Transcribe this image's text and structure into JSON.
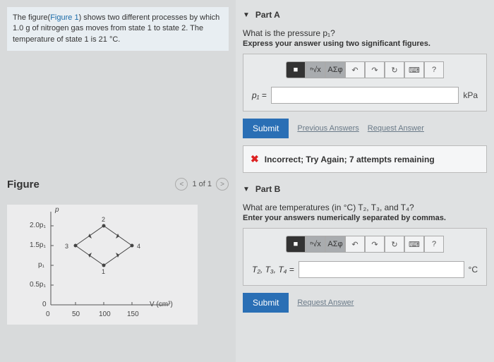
{
  "problem": {
    "text_before": "The figure(",
    "link": "Figure 1",
    "text_after": ") shows two different processes by which 1.0 g of nitrogen gas moves from state 1 to state 2. The temperature of state 1 is 21 °C."
  },
  "figure": {
    "heading": "Figure",
    "nav": "1 of 1",
    "ylabel": "p",
    "xlabel": "V (cm³)",
    "yticks": [
      "2.0p₁",
      "1.5p₁",
      "p₁",
      "0.5p₁",
      "0"
    ],
    "xticks": [
      "0",
      "50",
      "100",
      "150"
    ],
    "points": {
      "top": "2",
      "right": "4",
      "bottom": "1",
      "left": "3"
    }
  },
  "partA": {
    "title": "Part A",
    "question": "What is the pressure p₁?",
    "instruction": "Express your answer using two significant figures.",
    "varlabel": "p₁ =",
    "unit": "kPa",
    "submit": "Submit",
    "prev": "Previous Answers",
    "req": "Request Answer",
    "feedback": "Incorrect; Try Again; 7 attempts remaining"
  },
  "partB": {
    "title": "Part B",
    "question": "What are temperatures (in °C) T₂, T₃, and T₄?",
    "instruction": "Enter your answers numerically separated by commas.",
    "varlabel": "T₂, T₃, T₄ =",
    "unit": "°C",
    "submit": "Submit",
    "req": "Request Answer"
  },
  "toolbar": {
    "sqrt": "ⁿ√x",
    "greek": "ΑΣφ",
    "undo": "↶",
    "redo": "↷",
    "reset": "↻",
    "kbd": "⌨",
    "help": "?"
  },
  "chart_data": {
    "type": "line",
    "title": "",
    "xlabel": "V (cm³)",
    "ylabel": "p",
    "x_ticks": [
      0,
      50,
      100,
      150
    ],
    "y_ticks_label": [
      "0",
      "0.5p₁",
      "p₁",
      "1.5p₁",
      "2.0p₁"
    ],
    "ylim": [
      0,
      2.0
    ],
    "xlim": [
      0,
      150
    ],
    "series": [
      {
        "name": "state 1",
        "point": {
          "V": 100,
          "p_rel": 1.0
        }
      },
      {
        "name": "state 2",
        "point": {
          "V": 100,
          "p_rel": 2.0
        }
      },
      {
        "name": "state 3",
        "point": {
          "V": 50,
          "p_rel": 1.5
        }
      },
      {
        "name": "state 4",
        "point": {
          "V": 150,
          "p_rel": 1.5
        }
      }
    ],
    "paths": [
      {
        "from": 1,
        "via": 3,
        "to": 2
      },
      {
        "from": 1,
        "via": 4,
        "to": 2
      }
    ]
  }
}
